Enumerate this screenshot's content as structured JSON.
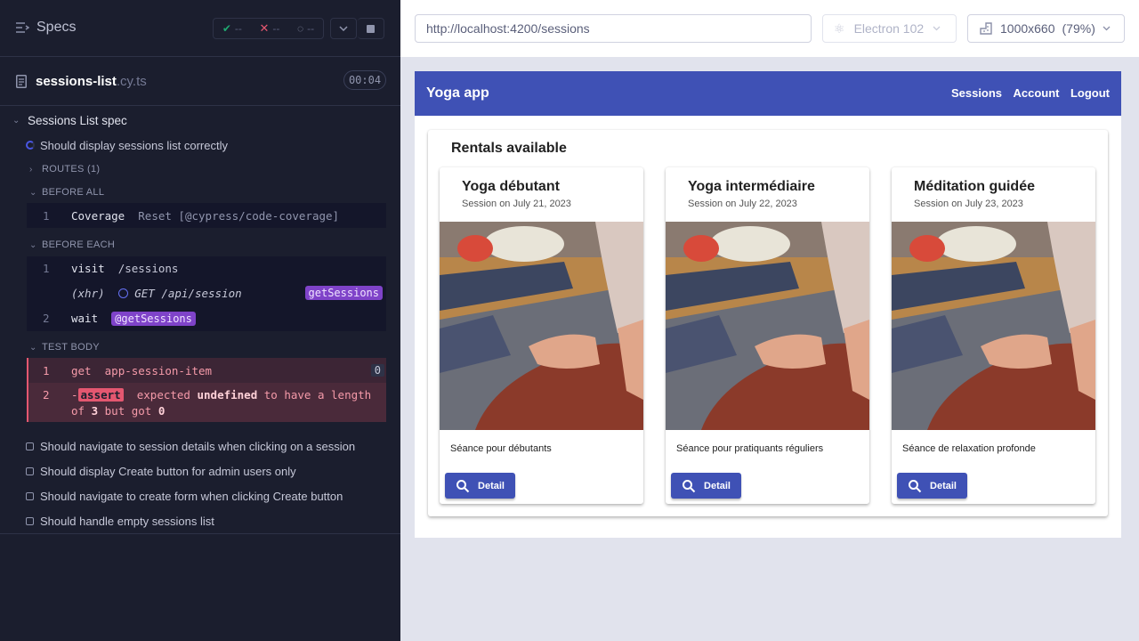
{
  "reporter": {
    "specs_label": "Specs",
    "stats": {
      "passed": "--",
      "failed": "--",
      "pending": "--"
    },
    "file": {
      "name": "sessions-list",
      "ext": ".cy.ts",
      "duration": "00:04"
    },
    "suite_title": "Sessions List spec",
    "running_test": "Should display sessions list correctly",
    "routes_label": "ROUTES (1)",
    "before_all_label": "BEFORE ALL",
    "before_all_cmds": [
      {
        "num": "1",
        "name": "Coverage",
        "arg": "Reset [@cypress/code-coverage]"
      }
    ],
    "before_each_label": "BEFORE EACH",
    "before_each_cmds": {
      "visit_num": "1",
      "visit_name": "visit",
      "visit_arg": "/sessions",
      "xhr_label": "(xhr)",
      "xhr_req": "GET /api/session",
      "xhr_alias": "getSessions",
      "wait_num": "2",
      "wait_name": "wait",
      "wait_alias": "@getSessions"
    },
    "test_body_label": "TEST BODY",
    "test_body_cmds": {
      "get_num": "1",
      "get_name": "get",
      "get_arg": "app-session-item",
      "get_count": "0",
      "assert_num": "2",
      "assert_dash": "-",
      "assert_badge": "assert",
      "assert_w1": "expected",
      "assert_w2": "undefined",
      "assert_w3": "to have a length",
      "assert_w4": "of",
      "assert_w5": "3",
      "assert_w6": "but got",
      "assert_w7": "0"
    },
    "other_tests": [
      "Should navigate to session details when clicking on a session",
      "Should display Create button for admin users only",
      "Should navigate to create form when clicking Create button",
      "Should handle empty sessions list"
    ]
  },
  "aut_header": {
    "url": "http://localhost:4200/sessions",
    "browser": "Electron 102",
    "viewport": "1000x660",
    "scale": "(79%)"
  },
  "app": {
    "title": "Yoga app",
    "nav": [
      "Sessions",
      "Account",
      "Logout"
    ],
    "list_title": "Rentals available",
    "sessions": [
      {
        "title": "Yoga débutant",
        "date": "Session on July 21, 2023",
        "description": "Séance pour débutants",
        "button": "Detail"
      },
      {
        "title": "Yoga intermédiaire",
        "date": "Session on July 22, 2023",
        "description": "Séance pour pratiquants réguliers",
        "button": "Detail"
      },
      {
        "title": "Méditation guidée",
        "date": "Session on July 23, 2023",
        "description": "Séance de relaxation profonde",
        "button": "Detail"
      }
    ]
  },
  "colors": {
    "primary": "#3f51b5",
    "reporter_bg": "#1b1e2e",
    "fail": "#e45770",
    "alias": "#7f43c9"
  }
}
